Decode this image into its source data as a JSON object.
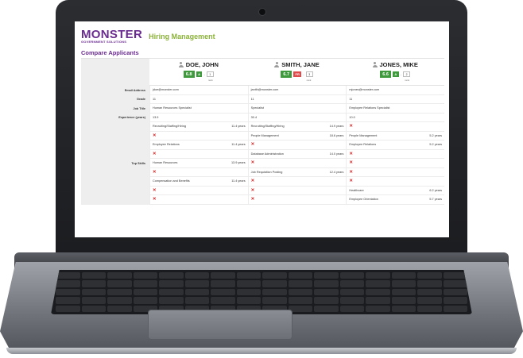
{
  "colors": {
    "brand_purple": "#6b2c91",
    "title_green": "#8bb23a",
    "score_green": "#3f9a3e",
    "grade_green": "#3f9a3e",
    "grade_red": "#e04b4b",
    "missing_red": "#e02424"
  },
  "brand": {
    "logo": "MONSTER",
    "logo_sub": "GOVERNMENT SOLUTIONS",
    "app_title": "Hiring Management"
  },
  "page": {
    "title": "Compare Applicants"
  },
  "labels": {
    "email": "Email Address",
    "grade": "Grade",
    "job_title": "Job Title",
    "experience": "Experience (years)",
    "top_skills": "Top Skills",
    "rank_caption": "rank"
  },
  "candidates": [
    {
      "name": "DOE, JOHN",
      "score": "6.8",
      "grade": "A",
      "grade_color": "#3f9a3e",
      "separator": "-",
      "rank": "1",
      "email": "jdoe@monster.com",
      "grade_level": "11",
      "job_title": "Human Resources Specialist",
      "experience": "13.9",
      "skills": [
        {
          "name": "Recruiting/Staffing/Hiring",
          "years": "11.4 years",
          "missing": false
        },
        {
          "name": "",
          "years": "",
          "missing": true
        },
        {
          "name": "Employee Relations",
          "years": "11.4 years",
          "missing": false
        },
        {
          "name": "",
          "years": "",
          "missing": true
        },
        {
          "name": "Human Resources",
          "years": "13.9 years",
          "missing": false
        },
        {
          "name": "",
          "years": "",
          "missing": true
        },
        {
          "name": "Compensation and Benefits",
          "years": "11.4 years",
          "missing": false
        },
        {
          "name": "",
          "years": "",
          "missing": true
        },
        {
          "name": "",
          "years": "",
          "missing": true
        }
      ]
    },
    {
      "name": "SMITH, JANE",
      "score": "6.7",
      "grade": "FR",
      "grade_color": "#e04b4b",
      "separator": "-",
      "rank": "3",
      "email": "janith@monster.com",
      "grade_level": "11",
      "job_title": "Specialist",
      "experience": "30.4",
      "skills": [
        {
          "name": "Recruiting/Staffing/Hiring",
          "years": "14.9 years",
          "missing": false
        },
        {
          "name": "People Management",
          "years": "18.6 years",
          "missing": false
        },
        {
          "name": "",
          "years": "",
          "missing": true
        },
        {
          "name": "Database Administration",
          "years": "14.0 years",
          "missing": false
        },
        {
          "name": "",
          "years": "",
          "missing": true
        },
        {
          "name": "Job Requisition Posting",
          "years": "12.4 years",
          "missing": false
        },
        {
          "name": "",
          "years": "",
          "missing": true
        },
        {
          "name": "",
          "years": "",
          "missing": true
        },
        {
          "name": "",
          "years": "",
          "missing": true
        }
      ]
    },
    {
      "name": "JONES, MIKE",
      "score": "6.6",
      "grade": "A",
      "grade_color": "#3f9a3e",
      "separator": "-",
      "rank": "2",
      "email": "mjones@monster.com",
      "grade_level": "11",
      "job_title": "Employee Relations Specialist",
      "experience": "10.0",
      "skills": [
        {
          "name": "",
          "years": "",
          "missing": true
        },
        {
          "name": "People Management",
          "years": "5.2 years",
          "missing": false
        },
        {
          "name": "Employee Relations",
          "years": "5.2 years",
          "missing": false
        },
        {
          "name": "",
          "years": "",
          "missing": true
        },
        {
          "name": "",
          "years": "",
          "missing": true
        },
        {
          "name": "",
          "years": "",
          "missing": true
        },
        {
          "name": "",
          "years": "",
          "missing": true
        },
        {
          "name": "Healthcare",
          "years": "6.2 years",
          "missing": false
        },
        {
          "name": "Employee Orientation",
          "years": "5.7 years",
          "missing": false
        }
      ]
    }
  ]
}
